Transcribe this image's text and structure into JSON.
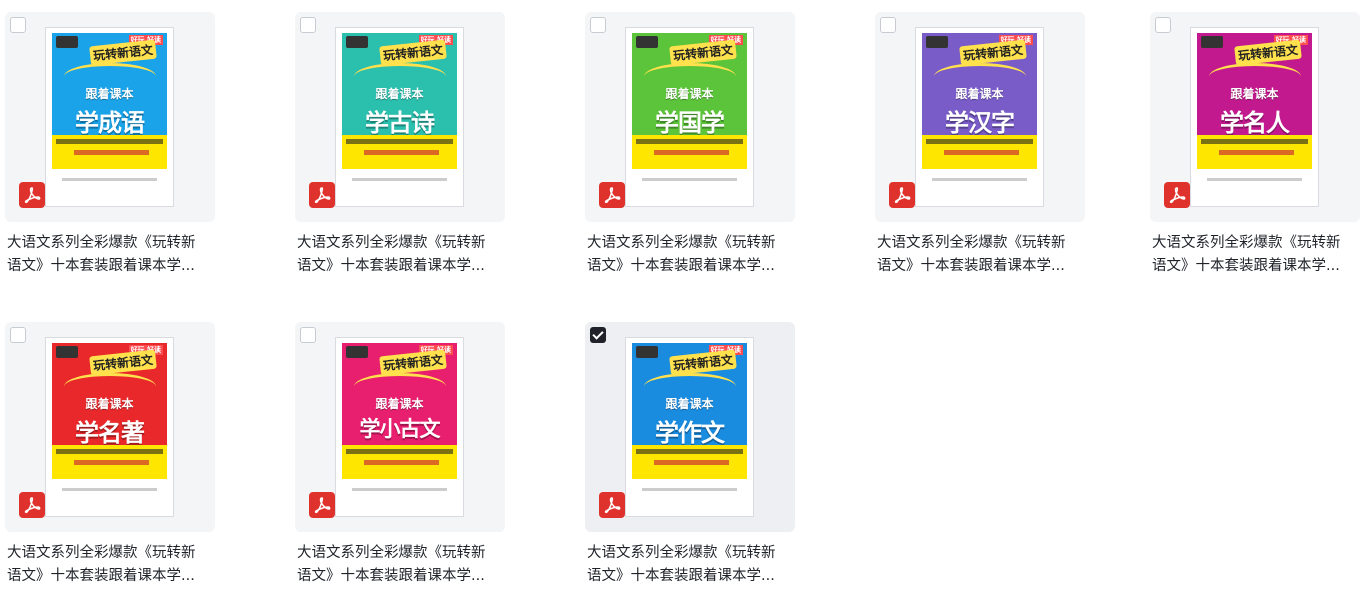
{
  "files": [
    {
      "title_line1": "大语文系列全彩爆款《玩转新",
      "title_line2": "语文》十本套装跟着课本学...",
      "subtitle": "跟着课本",
      "cover_title": "学成语",
      "cover_color": "#1aa3e8",
      "checked": false
    },
    {
      "title_line1": "大语文系列全彩爆款《玩转新",
      "title_line2": "语文》十本套装跟着课本学...",
      "subtitle": "跟着课本",
      "cover_title": "学古诗",
      "cover_color": "#2bbfae",
      "checked": false
    },
    {
      "title_line1": "大语文系列全彩爆款《玩转新",
      "title_line2": "语文》十本套装跟着课本学...",
      "subtitle": "跟着课本",
      "cover_title": "学国学",
      "cover_color": "#5cc43a",
      "checked": false
    },
    {
      "title_line1": "大语文系列全彩爆款《玩转新",
      "title_line2": "语文》十本套装跟着课本学...",
      "subtitle": "跟着课本",
      "cover_title": "学汉字",
      "cover_color": "#7a5cc9",
      "checked": false
    },
    {
      "title_line1": "大语文系列全彩爆款《玩转新",
      "title_line2": "语文》十本套装跟着课本学...",
      "subtitle": "跟着课本",
      "cover_title": "学名人",
      "cover_color": "#c21a8e",
      "checked": false
    },
    {
      "title_line1": "大语文系列全彩爆款《玩转新",
      "title_line2": "语文》十本套装跟着课本学...",
      "subtitle": "跟着课本",
      "cover_title": "学名著",
      "cover_color": "#e8282b",
      "checked": false
    },
    {
      "title_line1": "大语文系列全彩爆款《玩转新",
      "title_line2": "语文》十本套装跟着课本学...",
      "subtitle": "跟着课本",
      "cover_title": "学小古文",
      "cover_color": "#e81e6e",
      "checked": false
    },
    {
      "title_line1": "大语文系列全彩爆款《玩转新",
      "title_line2": "语文》十本套装跟着课本学...",
      "subtitle": "跟着课本",
      "cover_title": "学作文",
      "cover_color": "#1a8ce0",
      "checked": true
    }
  ],
  "cover_common": {
    "logo": "玩转新语文",
    "tagline": "好玩 好读"
  },
  "icons": {
    "file_type": "pdf-icon",
    "selection": "checkbox"
  }
}
